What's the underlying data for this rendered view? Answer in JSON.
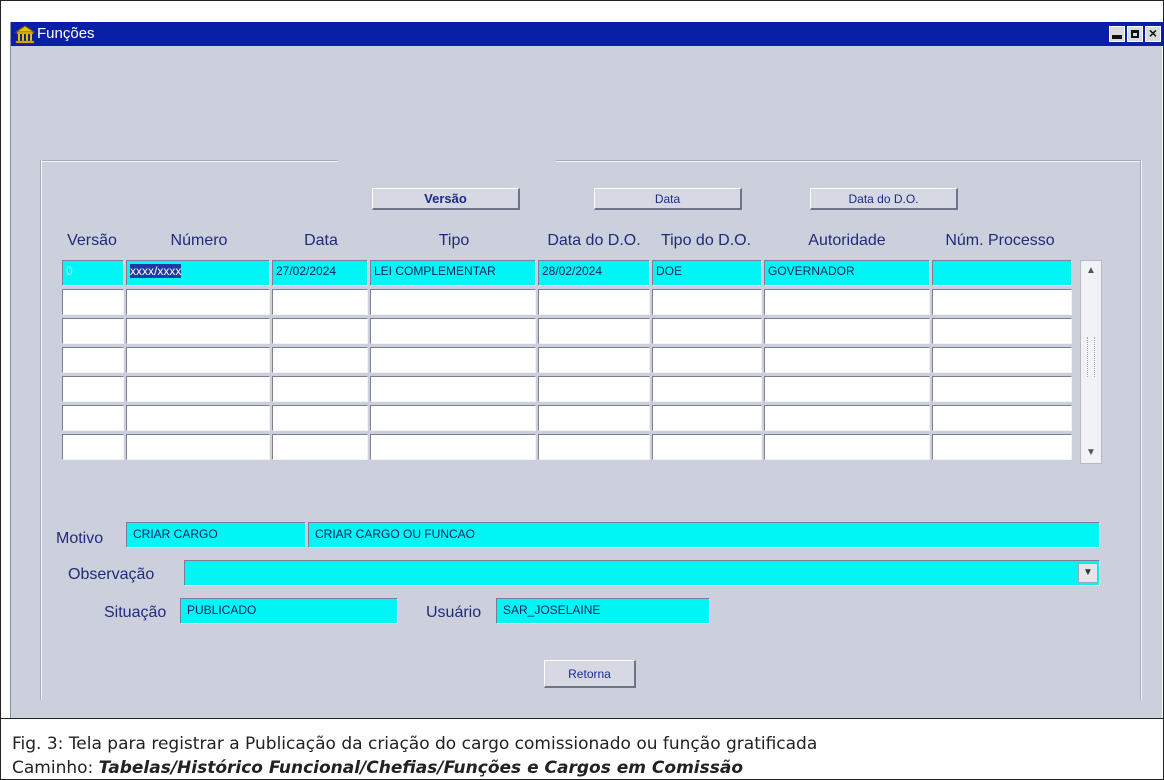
{
  "window": {
    "title": "Funções"
  },
  "sort_buttons": {
    "versao": "Versão",
    "data": "Data",
    "data_do": "Data do D.O."
  },
  "columns": [
    "Versão",
    "Número",
    "Data",
    "Tipo",
    "Data do D.O.",
    "Tipo do D.O.",
    "Autoridade",
    "Núm. Processo"
  ],
  "rows": [
    {
      "versao": "0",
      "numero": "xxxx/xxxx",
      "data": "27/02/2024",
      "tipo": "LEI COMPLEMENTAR",
      "data_do": "28/02/2024",
      "tipo_do": "DOE",
      "autoridade": "GOVERNADOR",
      "processo": ""
    },
    {
      "versao": "",
      "numero": "",
      "data": "",
      "tipo": "",
      "data_do": "",
      "tipo_do": "",
      "autoridade": "",
      "processo": ""
    },
    {
      "versao": "",
      "numero": "",
      "data": "",
      "tipo": "",
      "data_do": "",
      "tipo_do": "",
      "autoridade": "",
      "processo": ""
    },
    {
      "versao": "",
      "numero": "",
      "data": "",
      "tipo": "",
      "data_do": "",
      "tipo_do": "",
      "autoridade": "",
      "processo": ""
    },
    {
      "versao": "",
      "numero": "",
      "data": "",
      "tipo": "",
      "data_do": "",
      "tipo_do": "",
      "autoridade": "",
      "processo": ""
    },
    {
      "versao": "",
      "numero": "",
      "data": "",
      "tipo": "",
      "data_do": "",
      "tipo_do": "",
      "autoridade": "",
      "processo": ""
    },
    {
      "versao": "",
      "numero": "",
      "data": "",
      "tipo": "",
      "data_do": "",
      "tipo_do": "",
      "autoridade": "",
      "processo": ""
    }
  ],
  "form": {
    "motivo_label": "Motivo",
    "motivo_code": "CRIAR CARGO",
    "motivo_desc": "CRIAR CARGO OU FUNCAO",
    "observacao_label": "Observação",
    "observacao_value": "",
    "situacao_label": "Situação",
    "situacao_value": "PUBLICADO",
    "usuario_label": "Usuário",
    "usuario_value": "SAR_JOSELAINE",
    "retorna_label": "Retorna"
  },
  "caption": {
    "line1": "Fig. 3: Tela para registrar a Publicação da criação do cargo comissionado ou função gratificada",
    "line2_prefix": "Caminho: ",
    "line2_path": "Tabelas/Histórico Funcional/Chefias/Funções e Cargos em Comissão"
  }
}
